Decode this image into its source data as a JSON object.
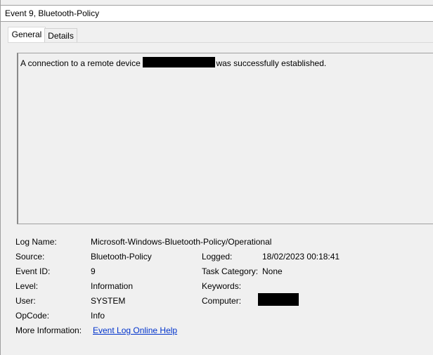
{
  "window": {
    "title": "Event 9, Bluetooth-Policy"
  },
  "tabs": [
    {
      "label": "General"
    },
    {
      "label": "Details"
    }
  ],
  "message": {
    "before": "A connection to a remote device",
    "after": "was successfully established."
  },
  "fields": {
    "log_name": {
      "label": "Log Name:",
      "value": "Microsoft-Windows-Bluetooth-Policy/Operational"
    },
    "source": {
      "label": "Source:",
      "value": "Bluetooth-Policy"
    },
    "logged": {
      "label": "Logged:",
      "value": "18/02/2023 00:18:41"
    },
    "event_id": {
      "label": "Event ID:",
      "value": "9"
    },
    "task_category": {
      "label": "Task Category:",
      "value": "None"
    },
    "level": {
      "label": "Level:",
      "value": "Information"
    },
    "keywords": {
      "label": "Keywords:",
      "value": ""
    },
    "user": {
      "label": "User:",
      "value": "SYSTEM"
    },
    "computer": {
      "label": "Computer:"
    },
    "opcode": {
      "label": "OpCode:",
      "value": "Info"
    },
    "more_info": {
      "label": "More Information:",
      "link": "Event Log Online Help"
    }
  }
}
